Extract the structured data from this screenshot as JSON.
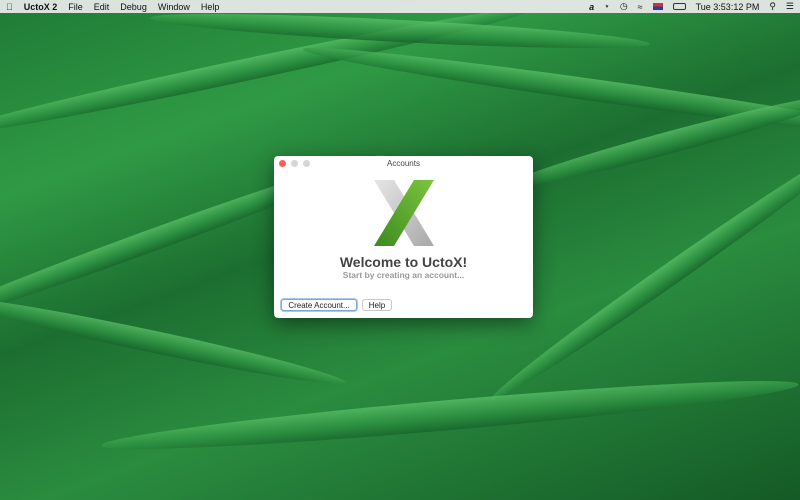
{
  "menubar": {
    "app": "UctoX 2",
    "items": [
      "File",
      "Edit",
      "Debug",
      "Window",
      "Help"
    ],
    "clock": "Tue 3:53:12 PM",
    "status_icons": [
      "input-source-icon",
      "bluetooth-icon",
      "time-machine-icon",
      "wifi-icon",
      "flag-icon",
      "battery-icon",
      "spotlight-icon",
      "notification-center-icon"
    ]
  },
  "window": {
    "title": "Accounts",
    "welcome": "Welcome to UctoX!",
    "subtitle": "Start by creating an account...",
    "buttons": {
      "create": "Create Account...",
      "help": "Help"
    }
  },
  "colors": {
    "accent": "#5fae2e",
    "wallpaper": "#2a8c3f"
  }
}
